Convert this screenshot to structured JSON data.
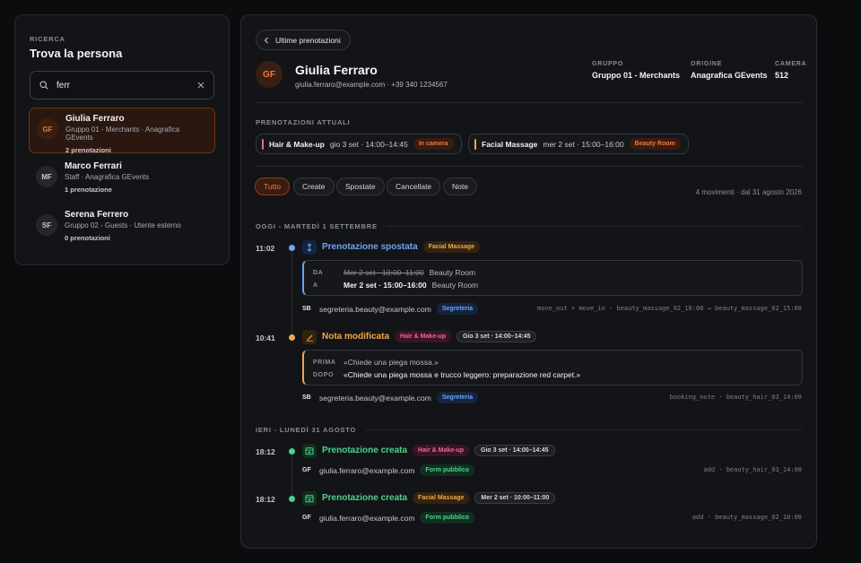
{
  "search": {
    "section_label": "Ricerca",
    "title": "Trova la persona",
    "query": "ferr"
  },
  "results": [
    {
      "initials": "GF",
      "name": "Giulia Ferraro",
      "sub": "Gruppo 01 - Merchants · Anagrafica GEvents",
      "count": "2 prenotazioni"
    },
    {
      "initials": "MF",
      "name": "Marco Ferrari",
      "sub": "Staff · Anagrafica GEvents",
      "count": "1 prenotazione"
    },
    {
      "initials": "SF",
      "name": "Serena Ferrero",
      "sub": "Gruppo 02 - Guests · Utente esterno",
      "count": "0 prenotazioni"
    }
  ],
  "detail": {
    "back_label": "Ultime prenotazioni",
    "initials": "GF",
    "name": "Giulia Ferraro",
    "contact": "giulia.ferraro@example.com · +39 340 1234567",
    "meta": [
      {
        "label": "Gruppo",
        "value": "Gruppo 01 - Merchants"
      },
      {
        "label": "Origine",
        "value": "Anagrafica GEvents"
      },
      {
        "label": "Camera",
        "value": "512"
      }
    ],
    "current_label": "Prenotazioni attuali",
    "current": [
      {
        "service": "Hair & Make-up",
        "when": "gio 3 set · 14:00–14:45",
        "status": "In camera",
        "color": "#f0669a"
      },
      {
        "service": "Facial Massage",
        "when": "mer 2 set · 15:00–16:00",
        "status": "Beauty Room",
        "color": "#f0a84a"
      }
    ],
    "filters": [
      "Tutto",
      "Create",
      "Spostate",
      "Cancellate",
      "Note"
    ],
    "summary": "4 movimenti · dal 31 agosto 2026"
  },
  "timeline": {
    "day1": "Oggi - martedì 1 settembre",
    "day2": "Ieri - lunedì 31 agosto",
    "events": [
      {
        "time": "11:02",
        "title": "Prenotazione spostata",
        "service_tag": "Facial Massage",
        "from_label": "DA",
        "from_when": "Mer 2 set · 10:00–11:00",
        "from_room": "Beauty Room",
        "to_label": "A",
        "to_when": "Mer 2 set · 15:00–16:00",
        "to_room": "Beauty Room",
        "actor_initials": "SB",
        "actor": "segreteria.beauty@example.com",
        "actor_tag": "Segreteria",
        "code": "move_out + move_in · beauty_massage_02_10:00 → beauty_massage_02_15:00",
        "color": "#6fa4f4"
      },
      {
        "time": "10:41",
        "title": "Nota modificata",
        "service_tag": "Hair & Make-up",
        "slot_tag": "Gio 3 set · 14:00–14:45",
        "before_label": "PRIMA",
        "before": "«Chiede una piega mossa.»",
        "after_label": "DOPO",
        "after": "«Chiede una piega mossa e trucco leggero: preparazione red carpet.»",
        "actor_initials": "SB",
        "actor": "segreteria.beauty@example.com",
        "actor_tag": "Segreteria",
        "code": "booking_note · beauty_hair_03_14:00",
        "color": "#f0a84a"
      },
      {
        "time": "18:12",
        "title": "Prenotazione creata",
        "service_tag": "Hair & Make-up",
        "slot_tag": "Gio 3 set · 14:00–14:45",
        "actor_initials": "GF",
        "actor": "giulia.ferraro@example.com",
        "actor_tag": "Form pubblico",
        "code": "add · beauty_hair_03_14:00",
        "color": "#4dd28c"
      },
      {
        "time": "18:12",
        "title": "Prenotazione creata",
        "service_tag": "Facial Massage",
        "slot_tag": "Mer 2 set · 10:00–11:00",
        "actor_initials": "GF",
        "actor": "giulia.ferraro@example.com",
        "actor_tag": "Form pubblico",
        "code": "add · beauty_massage_02_10:00",
        "color": "#4dd28c"
      }
    ]
  }
}
